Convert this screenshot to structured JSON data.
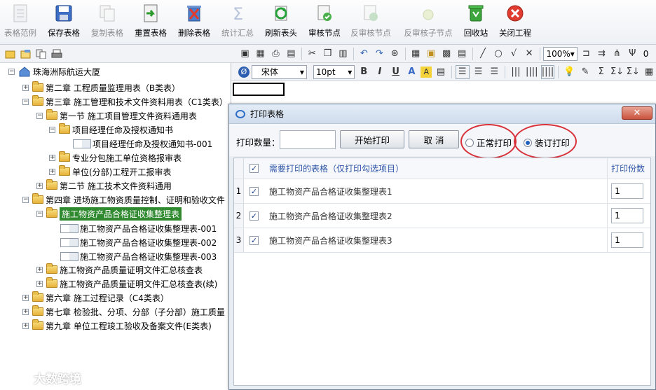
{
  "toolbar": {
    "items": [
      {
        "label": "表格范例",
        "icon": "document-icon",
        "enabled": false
      },
      {
        "label": "保存表格",
        "icon": "save-icon",
        "enabled": true
      },
      {
        "label": "复制表格",
        "icon": "copy-icon",
        "enabled": false
      },
      {
        "label": "重置表格",
        "icon": "reset-icon",
        "enabled": true
      },
      {
        "label": "删除表格",
        "icon": "delete-icon",
        "enabled": true
      },
      {
        "label": "统计汇总",
        "icon": "sigma-icon",
        "enabled": false
      },
      {
        "label": "刷新表头",
        "icon": "refresh-icon",
        "enabled": true
      },
      {
        "label": "审核节点",
        "icon": "audit-icon",
        "enabled": true
      },
      {
        "label": "反审核节点",
        "icon": "unaudit-icon",
        "enabled": false
      },
      {
        "label": "反审核子节点",
        "icon": "unaudit-child-icon",
        "enabled": false
      },
      {
        "label": "回收站",
        "icon": "recycle-bin-icon",
        "enabled": true
      },
      {
        "label": "关闭工程",
        "icon": "close-icon",
        "enabled": true
      }
    ]
  },
  "tree": {
    "root": "珠海洲际航运大厦",
    "nodes": [
      {
        "label": "第二章  工程质量监理用表（B类表）"
      },
      {
        "label": "第三章  施工管理和技术文件资料用表（C1类表）"
      },
      {
        "label": "第一节  施工项目管理文件资料通用表"
      },
      {
        "label": "项目经理任命及授权通知书"
      },
      {
        "label": "项目经理任命及授权通知书-001"
      },
      {
        "label": "专业分包施工单位资格报审表"
      },
      {
        "label": "单位(分部)工程开工报审表"
      },
      {
        "label": "第二节  施工技术文件资料通用"
      },
      {
        "label": "第四章  进场施工物资质量控制、证明和验收文件"
      },
      {
        "label": "施工物资产品合格证收集整理表"
      },
      {
        "label": "施工物资产品合格证收集整理表-001"
      },
      {
        "label": "施工物资产品合格证收集整理表-002"
      },
      {
        "label": "施工物资产品合格证收集整理表-003"
      },
      {
        "label": "施工物资产品质量证明文件汇总核查表"
      },
      {
        "label": "施工物资产品质量证明文件汇总核查表(续)"
      },
      {
        "label": "第六章  施工过程记录（C4类表）"
      },
      {
        "label": "第七章  检验批、分项、分部（子分部）施工质量"
      },
      {
        "label": "第九章  单位工程竣工验收及备案文件(E类表)"
      }
    ]
  },
  "format": {
    "font": "宋体",
    "size": "10pt",
    "zoom": "100%",
    "rotate": "0"
  },
  "dialog": {
    "title": "打印表格",
    "close_symbol": "✕",
    "count_label": "打印数量：",
    "count_value": "",
    "start_button": "开始打印",
    "cancel_button": "取 消",
    "radio_normal": "正常打印",
    "radio_binding": "装订打印",
    "selected_mode": "装订打印",
    "table_header": "需要打印的表格（仅打印勾选项目）",
    "copies_header": "打印份数",
    "rows": [
      {
        "index": "1",
        "name": "施工物资产品合格证收集整理表1",
        "copies": "1",
        "checked": true
      },
      {
        "index": "2",
        "name": "施工物资产品合格证收集整理表2",
        "copies": "1",
        "checked": true
      },
      {
        "index": "3",
        "name": "施工物资产品合格证收集整理表3",
        "copies": "1",
        "checked": true
      }
    ]
  },
  "watermark": "大数跨境",
  "colors": {
    "selected_node": "#2f8a2f",
    "annotation_ring": "#d8313a",
    "dialog_close": "#c9533c"
  }
}
